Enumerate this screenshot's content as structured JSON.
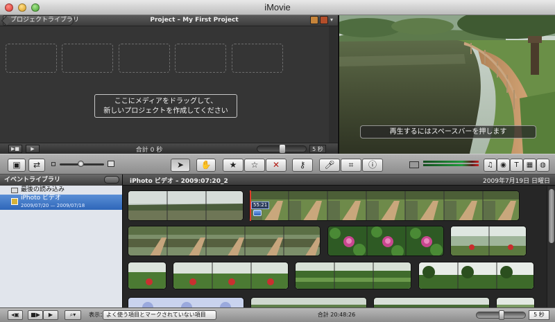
{
  "window": {
    "title": "iMovie"
  },
  "project": {
    "back_label": "プロジェクトライブラリ",
    "title": "Project – My First Project",
    "drop_message_line1": "ここにメディアをドラッグして、",
    "drop_message_line2": "新しいプロジェクトを作成してください",
    "total": "合計 0 秒",
    "zoom_value": "5 秒"
  },
  "viewer": {
    "message": "再生するにはスペースバーを押します"
  },
  "toolbar": {
    "tools": [
      "arrow-tool",
      "hand-tool",
      "favorite-star",
      "unmark-star",
      "reject-x",
      "keyword-tool",
      "voiceover-mic",
      "crop-tool",
      "info-tool"
    ],
    "browser_buttons": [
      "music-icon",
      "photo-icon",
      "title-icon",
      "transition-icon",
      "map-icon"
    ]
  },
  "event_library": {
    "header": "イベントライブラリ",
    "items": [
      {
        "label": "最後の読み込み"
      },
      {
        "label": "iPhoto ビデオ",
        "dates": "2009/07/20 — 2009/07/18",
        "selected": true
      }
    ]
  },
  "event_browser": {
    "title": "iPhoto ビデオ – 2009:07:20_2",
    "date": "2009年7月19日 日曜日",
    "clip_time": "55:21"
  },
  "bottom_bar": {
    "show_label": "表示：",
    "show_option": "よく使う項目とマークされていない項目",
    "total": "合計 20:48:26",
    "zoom_value": "5 秒"
  },
  "colors": {
    "selection": "#3a74c8",
    "playhead": "#e23b2a"
  }
}
